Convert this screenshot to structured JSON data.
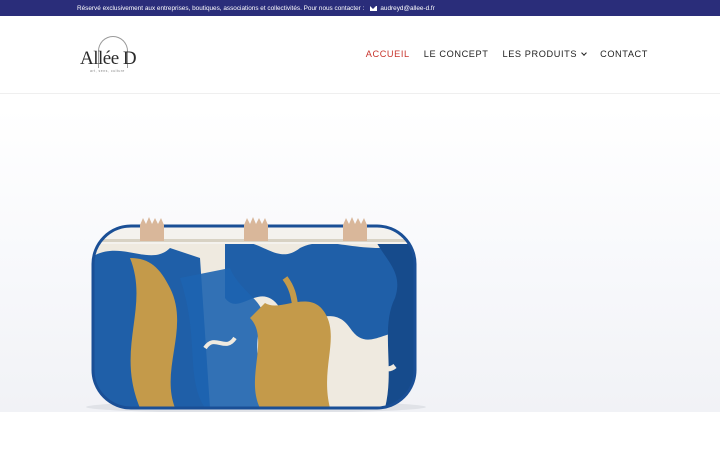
{
  "topbar": {
    "notice": "Réservé exclusivement aux entreprises, boutiques, associations et collectivités. Pour nous contacter :",
    "email": "audreyd@allee-d.fr",
    "mail_icon": "envelope-icon",
    "bg_color": "#2a2d7a"
  },
  "brand": {
    "logo_text": "Allée D",
    "tagline": "art, sens, culture"
  },
  "nav": {
    "items": [
      {
        "label": "ACCUEIL",
        "active": true
      },
      {
        "label": "LE CONCEPT",
        "active": false
      },
      {
        "label": "LES PRODUITS",
        "active": false,
        "has_dropdown": true
      },
      {
        "label": "CONTACT",
        "active": false
      }
    ],
    "active_color": "#c8352d",
    "dropdown_icon": "chevron-down-icon"
  },
  "hero": {
    "subject": "product-image",
    "colors": {
      "blue": "#1f5fa8",
      "gold": "#c49a4a",
      "cream": "#efeae0"
    }
  }
}
